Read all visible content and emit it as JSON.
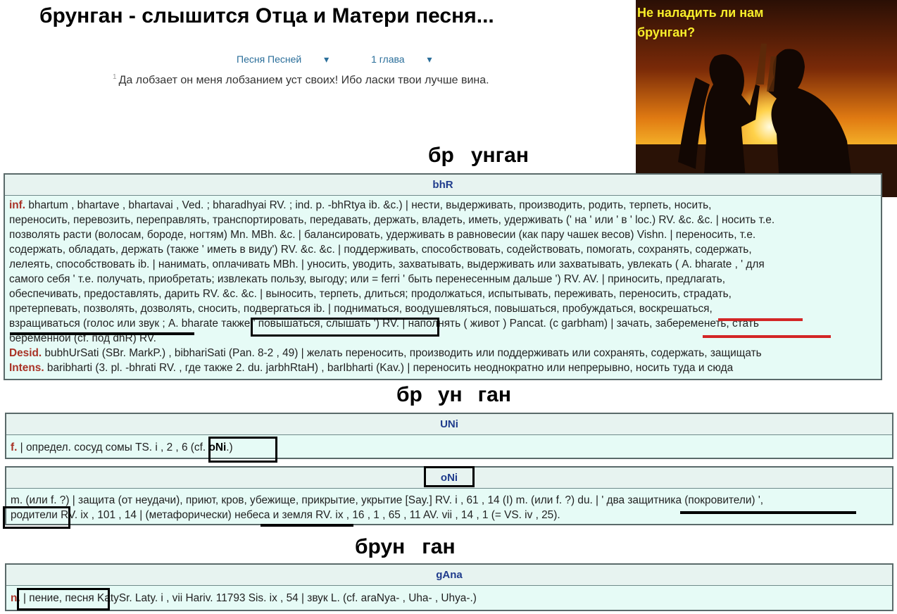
{
  "title": "брунган - слышится Отца и Матери песня...",
  "nav": {
    "book": "Песня Песней",
    "chapter": "1 глава"
  },
  "verse": {
    "number": "1",
    "text": "Да лобзает он меня лобзанием уст своих! Ибо ласки твои лучше вина."
  },
  "photo": {
    "caption": "Не наладить ли нам брунган?"
  },
  "split_headings": {
    "h1_a": "бр",
    "h1_b": "унган",
    "h2_a": "бр",
    "h2_b": "ун",
    "h2_c": "ган",
    "h3_a": "брун",
    "h3_b": "ган"
  },
  "bhR": {
    "head": "bhR",
    "line1": "bhartum , bhartave , bhartavai , Ved. ; bharadhyai RV. ; ind. p. -bhRtya ib. &c.) | нести, выдерживать, производить, родить, терпеть, носить,",
    "line2": "переносить, перевозить, переправлять, транспортировать, передавать, держать, владеть, иметь, удерживать (' на ' или ' в ' loc.) RV. &c. &c. | носить т.е.",
    "line3": "позволять расти (волосам, бороде, ногтям) Mn. MBh. &c. | балансировать, удерживать в равновесии (как пару чашек весов) Vishn. | переносить, т.е.",
    "line4": "содержать, обладать, держать (также ' иметь в виду') RV. &c. &c. | поддерживать, способствовать, содействовать, помогать, сохранять, содержать,",
    "line5": "лелеять, способствовать ib. | нанимать, оплачивать MBh. | уносить, уводить, захватывать, выдерживать или захватывать, увлекать ( A. bharate , ' для",
    "line6": "самого себя ' т.е. получать, приобретать; извлекать пользу, выгоду; или = ferri ' быть перенесенным дальше ') RV. AV. | приносить, предлагать,",
    "line7": "обеспечивать, предоставлять, дарить RV. &c. &c. | выносить, терпеть, длиться; продолжаться, испытывать, переживать, переносить, страдать,",
    "line8": "претерпевать, позволять, дозволять, сносить, подвергаться ib. | подниматься, воодушевляться, повышаться, пробуждаться, воскрешаться,",
    "line9": "взращиваться (голос или звук ; A. bharate также ' повышаться, слышать ') RV. | наполнять ( живот ) Pancat. (с garbham) | зачать, забеременеть, стать",
    "line10": "беременной (cf. под dhR) RV.",
    "line11": "bubhUrSati (SBr. MarkP.) , bibhariSati (Pan. 8-2 , 49) | желать переносить, производить или поддерживать или сохранять, содержать, защищать",
    "line12": "baribharti (3. pl. -bhrati RV. , где также 2. du. jarbhRtaH) , barIbharti (Kav.) | переносить неоднократно или непрерывно, носить туда и сюда",
    "inf": "inf.",
    "desid": "Desid.",
    "intens": "Intens."
  },
  "UNi": {
    "head": "UNi",
    "gram": "f.",
    "text": " | определ. сосуд сомы TS. i , 2 , 6 (cf. ",
    "ref": "oNi",
    "tail": ".)"
  },
  "oNi": {
    "head": "oNi",
    "line1": "m. (или f. ?) | защита (от неудачи), приют, кров, убежище, прикрытие, укрытие [Say.] RV. i , 61 , 14 (I) m. (или f. ?) du. | ' два защитника (покровители) ',",
    "line2": "родители RV. ix , 101 , 14 | (метафорически) небеса и земля RV. ix , 16 , 1 , 65 , 11 AV. vii , 14 , 1 (= VS. iv , 25)."
  },
  "gAna": {
    "head": "gAna",
    "gram": "n.",
    "text": " | пение, песня KatySr. Laty. i , vii Hariv. 11793 Sis. ix , 54 | звук L. (cf. araNya- , Uha- , Uhya-.)"
  },
  "colors": {
    "entry_bg": "#e6fbf6",
    "head_text": "#1f3b8c",
    "gram": "#a93226",
    "underline_red": "#d32626",
    "caption": "#f8ee2a"
  }
}
